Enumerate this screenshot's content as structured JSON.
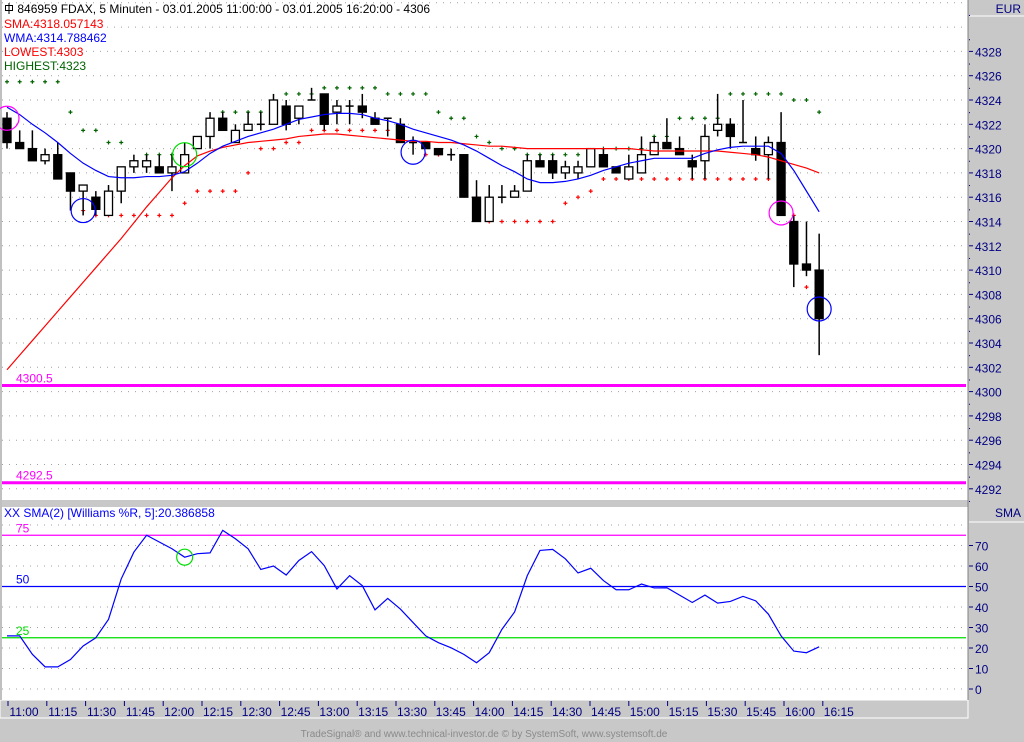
{
  "header": {
    "title": "846959  FDAX, 5 Minuten - 03.01.2005 11:00:00 - 03.01.2005 16:20:00 - 4306",
    "sma": "SMA:4318.057143",
    "wma": "WMA:4314.788462",
    "lowest": "LOWEST:4303",
    "highest": "HIGHEST:4323",
    "title_icon": "crosshair-icon"
  },
  "axis": {
    "currency": "EUR",
    "lower_header": "SMA"
  },
  "lower": {
    "label": "XX SMA(2) [Williams %R, 5]:20.386858"
  },
  "footer": "TradeSignal® and www.technical-investor.de © by  SystemSoft, www.systemsoft.de",
  "colors": {
    "sma": "#ff0000",
    "wma": "#0000ff",
    "highest": "#006400",
    "lowest": "#ff0000",
    "levels": "#ff00ff",
    "axis_text": "#000080"
  },
  "chart_data": [
    {
      "type": "candlestick",
      "title": "846959 FDAX, 5 Minuten",
      "ylim": [
        4291,
        4332
      ],
      "yticks": [
        4292,
        4294,
        4296,
        4298,
        4300,
        4302,
        4304,
        4306,
        4308,
        4310,
        4312,
        4314,
        4316,
        4318,
        4320,
        4322,
        4324,
        4326,
        4328
      ],
      "xticks": [
        "11:00",
        "11:15",
        "11:30",
        "11:45",
        "12:00",
        "12:15",
        "12:30",
        "12:45",
        "13:00",
        "13:15",
        "13:30",
        "13:45",
        "14:00",
        "14:15",
        "14:30",
        "14:45",
        "15:00",
        "15:15",
        "15:30",
        "15:45",
        "16:00",
        "16:15"
      ],
      "ohlc": [
        [
          4322.5,
          4323,
          4320,
          4320.5
        ],
        [
          4320.5,
          4321.5,
          4320,
          4320
        ],
        [
          4320,
          4321.5,
          4319,
          4319
        ],
        [
          4319,
          4320,
          4318.7,
          4319.5
        ],
        [
          4319.5,
          4320.5,
          4317.5,
          4317.5
        ],
        [
          4318,
          4318,
          4314.9,
          4316.5
        ],
        [
          4316.5,
          4317,
          4314.5,
          4317
        ],
        [
          4316,
          4316.5,
          4314.5,
          4315
        ],
        [
          4314.5,
          4317,
          4314.5,
          4316.5
        ],
        [
          4316.5,
          4318.5,
          4315.5,
          4318.5
        ],
        [
          4318.5,
          4319.5,
          4318,
          4319
        ],
        [
          4318.5,
          4319.5,
          4318,
          4319
        ],
        [
          4318.5,
          4319.5,
          4318,
          4318
        ],
        [
          4318,
          4319.5,
          4316.5,
          4318.5
        ],
        [
          4318,
          4320.5,
          4318,
          4319.5
        ],
        [
          4320,
          4321,
          4320,
          4321
        ],
        [
          4321,
          4323,
          4320,
          4322.5
        ],
        [
          4322.5,
          4323,
          4321.5,
          4321.5
        ],
        [
          4320.5,
          4322,
          4320.5,
          4321.5
        ],
        [
          4321.5,
          4323,
          4321.5,
          4322
        ],
        [
          4322,
          4323,
          4321.5,
          4322
        ],
        [
          4322,
          4324.5,
          4322,
          4324
        ],
        [
          4323.5,
          4324,
          4321.5,
          4322
        ],
        [
          4322.5,
          4323.5,
          4322,
          4323.5
        ],
        [
          4324,
          4325,
          4324,
          4324
        ],
        [
          4324.5,
          4324.5,
          4321.5,
          4322
        ],
        [
          4323,
          4324,
          4322,
          4323.5
        ],
        [
          4323.5,
          4324,
          4322,
          4323.5
        ],
        [
          4323.5,
          4324.5,
          4322.5,
          4323
        ],
        [
          4322.5,
          4323,
          4322,
          4322
        ],
        [
          4322.5,
          4322.5,
          4321,
          4322.5
        ],
        [
          4322,
          4322.5,
          4320.5,
          4320.5
        ],
        [
          4320.5,
          4321,
          4319.5,
          4320.5
        ],
        [
          4320.5,
          4320.5,
          4320,
          4320
        ],
        [
          4320,
          4320,
          4319.5,
          4319.5
        ],
        [
          4319.5,
          4320,
          4319,
          4319.5
        ],
        [
          4319.5,
          4319.5,
          4316,
          4316
        ],
        [
          4316,
          4317.4,
          4314,
          4314
        ],
        [
          4314,
          4317,
          4314,
          4316
        ],
        [
          4316,
          4317,
          4315.5,
          4316
        ],
        [
          4316,
          4317,
          4316,
          4316.5
        ],
        [
          4316.5,
          4319.5,
          4316.5,
          4319
        ],
        [
          4319,
          4319.5,
          4318.5,
          4318.5
        ],
        [
          4319,
          4319.5,
          4317.5,
          4318
        ],
        [
          4318,
          4319,
          4317.5,
          4318.5
        ],
        [
          4318,
          4319,
          4317.5,
          4318.5
        ],
        [
          4318.5,
          4320,
          4318.5,
          4320
        ],
        [
          4319.5,
          4320,
          4318.5,
          4318.5
        ],
        [
          4318.5,
          4318.5,
          4318,
          4318
        ],
        [
          4317.5,
          4319.5,
          4317.5,
          4318.5
        ],
        [
          4318,
          4321,
          4318,
          4319.5
        ],
        [
          4319.5,
          4321,
          4319.5,
          4320.5
        ],
        [
          4320.5,
          4322.5,
          4320,
          4320
        ],
        [
          4320,
          4321,
          4319.5,
          4319.5
        ],
        [
          4319,
          4319.5,
          4317.5,
          4318.5
        ],
        [
          4319,
          4322,
          4317.5,
          4321
        ],
        [
          4321.5,
          4324.5,
          4321,
          4322
        ],
        [
          4322,
          4322.5,
          4320,
          4321
        ],
        [
          4320.5,
          4324,
          4320.5,
          4320.5
        ],
        [
          4320,
          4321,
          4319,
          4319.5
        ],
        [
          4319.5,
          4321,
          4317.5,
          4320.5
        ],
        [
          4320.5,
          4323,
          4314.5,
          4314.5
        ],
        [
          4314,
          4314.5,
          4308.6,
          4310.5
        ],
        [
          4310.5,
          4314,
          4309.5,
          4310
        ],
        [
          4310,
          4313,
          4303,
          4306
        ]
      ],
      "series": [
        {
          "name": "SMA",
          "values": [
            4301.8,
            4303.0,
            4304.2,
            4305.4,
            4306.6,
            4307.8,
            4309.0,
            4310.2,
            4311.4,
            4312.6,
            4313.9,
            4315.2,
            4316.4,
            4317.6,
            4318.6,
            4319.4,
            4319.8,
            4320.1,
            4320.3,
            4320.5,
            4320.6,
            4320.7,
            4320.8,
            4321.0,
            4321.1,
            4321.2,
            4321.2,
            4321.1,
            4321.0,
            4320.9,
            4320.8,
            4320.7,
            4320.6,
            4320.6,
            4320.5,
            4320.5,
            4320.4,
            4320.3,
            4320.2,
            4320.2,
            4320.1,
            4320.0,
            4320.0,
            4320.0,
            4320.0,
            4320.0,
            4320.0,
            4320.0,
            4320.0,
            4320.0,
            4319.9,
            4319.8,
            4319.8,
            4319.8,
            4319.8,
            4319.8,
            4319.8,
            4319.7,
            4319.6,
            4319.5,
            4319.3,
            4319.0,
            4318.7,
            4318.4,
            4318.0
          ]
        },
        {
          "name": "WMA",
          "values": [
            4323.4,
            4322.8,
            4322.0,
            4321.3,
            4320.5,
            4319.6,
            4318.8,
            4318.2,
            4317.7,
            4317.6,
            4317.6,
            4317.7,
            4317.7,
            4317.8,
            4318.1,
            4318.8,
            4319.6,
            4320.2,
            4320.6,
            4321.0,
            4321.3,
            4321.6,
            4322.0,
            4322.4,
            4322.6,
            4322.8,
            4322.9,
            4322.9,
            4322.8,
            4322.5,
            4322.3,
            4322.0,
            4321.6,
            4321.3,
            4321.0,
            4320.7,
            4320.3,
            4319.8,
            4319.2,
            4318.6,
            4318.1,
            4317.5,
            4317.2,
            4317.2,
            4317.3,
            4317.5,
            4317.8,
            4318.2,
            4318.5,
            4318.8,
            4319.0,
            4319.2,
            4319.2,
            4319.2,
            4319.2,
            4319.6,
            4319.9,
            4320.1,
            4320.2,
            4320.2,
            4320.2,
            4319.6,
            4318.2,
            4316.5,
            4314.8
          ]
        }
      ],
      "highest_lowest_period": 5,
      "prior_highest": 4325.5,
      "levels": [
        {
          "value": 4300.5,
          "label": "4300.5"
        },
        {
          "value": 4292.5,
          "label": "4292.5"
        }
      ],
      "circles": [
        {
          "bar": 0,
          "value": 4322.5,
          "color": "#ff00ff"
        },
        {
          "bar": 6,
          "value": 4314.9,
          "color": "#0000ff"
        },
        {
          "bar": 14,
          "value": 4319.5,
          "color": "#00dd00"
        },
        {
          "bar": 32,
          "value": 4319.7,
          "color": "#0000ff"
        },
        {
          "bar": 61,
          "value": 4314.7,
          "color": "#ff00ff"
        },
        {
          "bar": 64,
          "value": 4306.8,
          "color": "#0000ff"
        }
      ]
    },
    {
      "type": "line",
      "title": "XX SMA(2) [Williams %R, 5]",
      "ylim": [
        0,
        80
      ],
      "yticks": [
        0,
        10,
        20,
        30,
        40,
        50,
        60,
        70
      ],
      "values": [
        25.9,
        25.9,
        16.9,
        10.8,
        10.8,
        14.4,
        21,
        25,
        34,
        53.7,
        66.8,
        75,
        71.7,
        68.4,
        64.3,
        66,
        66.4,
        77.4,
        73.3,
        68.4,
        58.3,
        60,
        55.6,
        62.7,
        67,
        60.2,
        48.8,
        55.3,
        50.4,
        38.6,
        44.2,
        39,
        32.4,
        25.9,
        22.6,
        20.1,
        16.9,
        12.8,
        17.7,
        29.1,
        37.6,
        55.3,
        67.6,
        68.1,
        63.5,
        56.6,
        58.9,
        52.9,
        48.4,
        48.4,
        51.2,
        49.3,
        49.4,
        45.8,
        42.2,
        45.8,
        41.9,
        42.7,
        45.2,
        43,
        36.5,
        25.9,
        18.5,
        17.7,
        20.6
      ],
      "levels": [
        {
          "value": 75,
          "label": "75",
          "color": "#ff00ff"
        },
        {
          "value": 50,
          "label": "50",
          "color": "#0000ff"
        },
        {
          "value": 25,
          "label": "25",
          "color": "#00dd00"
        }
      ],
      "circles": [
        {
          "bar": 14,
          "value": 64.3,
          "color": "#00dd00"
        }
      ]
    }
  ]
}
